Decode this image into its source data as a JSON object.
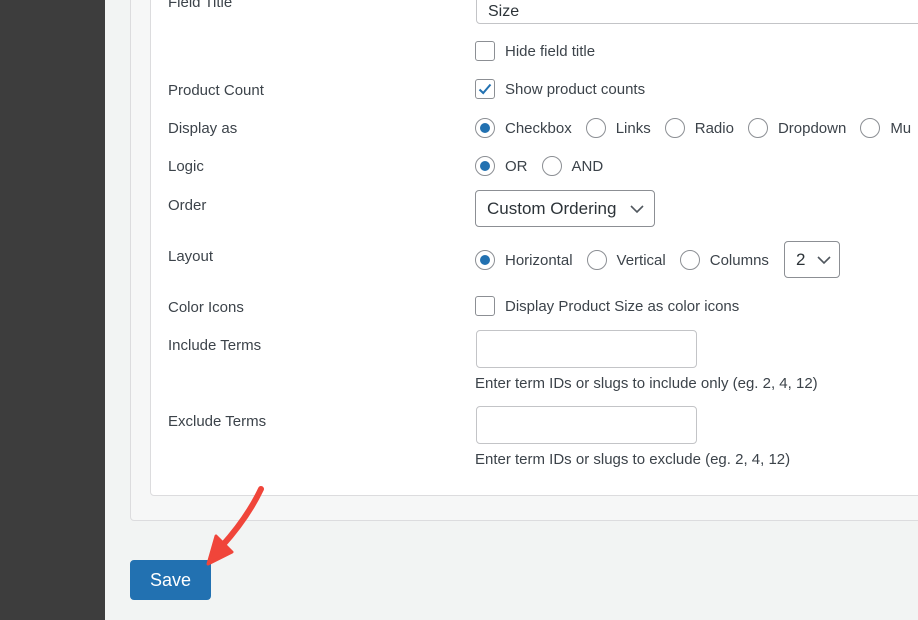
{
  "form": {
    "field_title": {
      "label": "Field Title",
      "value": "Size",
      "hide_label": "Hide field title",
      "hide_checked": false
    },
    "product_count": {
      "label": "Product Count",
      "option_label": "Show product counts",
      "checked": true
    },
    "display_as": {
      "label": "Display as",
      "options": [
        "Checkbox",
        "Links",
        "Radio",
        "Dropdown",
        "Mu"
      ],
      "selected": "Checkbox"
    },
    "logic": {
      "label": "Logic",
      "options": [
        "OR",
        "AND"
      ],
      "selected": "OR"
    },
    "order": {
      "label": "Order",
      "selected": "Custom Ordering"
    },
    "layout": {
      "label": "Layout",
      "options": [
        "Horizontal",
        "Vertical",
        "Columns"
      ],
      "selected": "Horizontal",
      "columns_value": "2"
    },
    "color_icons": {
      "label": "Color Icons",
      "option_label": "Display Product Size as color icons",
      "checked": false
    },
    "include_terms": {
      "label": "Include Terms",
      "value": "",
      "hint": "Enter term IDs or slugs to include only (eg. 2, 4, 12)"
    },
    "exclude_terms": {
      "label": "Exclude Terms",
      "value": "",
      "hint": "Enter term IDs or slugs to exclude (eg. 2, 4, 12)"
    }
  },
  "actions": {
    "save_label": "Save"
  },
  "colors": {
    "accent": "#2271b1",
    "arrow": "#f0453a",
    "sidebar": "#3d3d3d"
  },
  "icons": {
    "check": "checkmark-icon",
    "chevron": "chevron-down-icon",
    "annotation": "red-arrow-icon"
  }
}
